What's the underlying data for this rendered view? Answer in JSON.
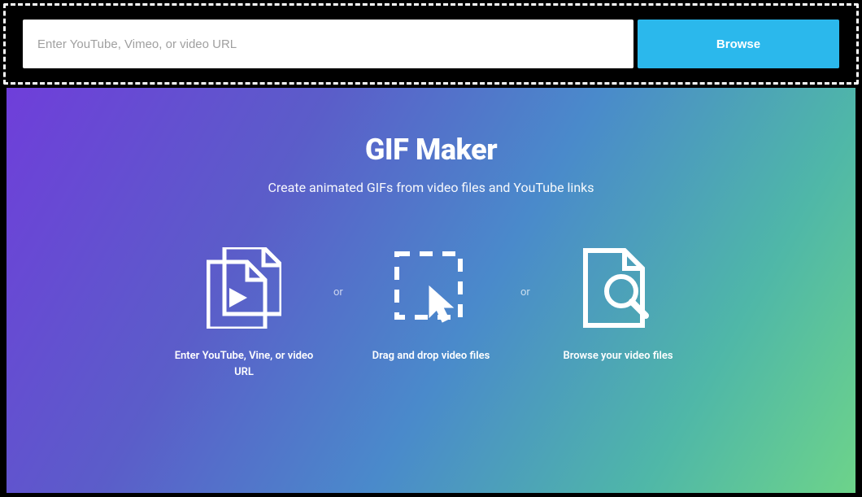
{
  "topBar": {
    "urlPlaceholder": "Enter YouTube, Vimeo, or video URL",
    "browseLabel": "Browse"
  },
  "main": {
    "title": "GIF Maker",
    "subtitle": "Create animated GIFs from video files and YouTube links",
    "separator": "or",
    "options": [
      {
        "label": "Enter YouTube, Vine, or video URL",
        "icon": "video-files-icon"
      },
      {
        "label": "Drag and drop video files",
        "icon": "drag-drop-icon"
      },
      {
        "label": "Browse your video files",
        "icon": "browse-file-icon"
      }
    ]
  }
}
